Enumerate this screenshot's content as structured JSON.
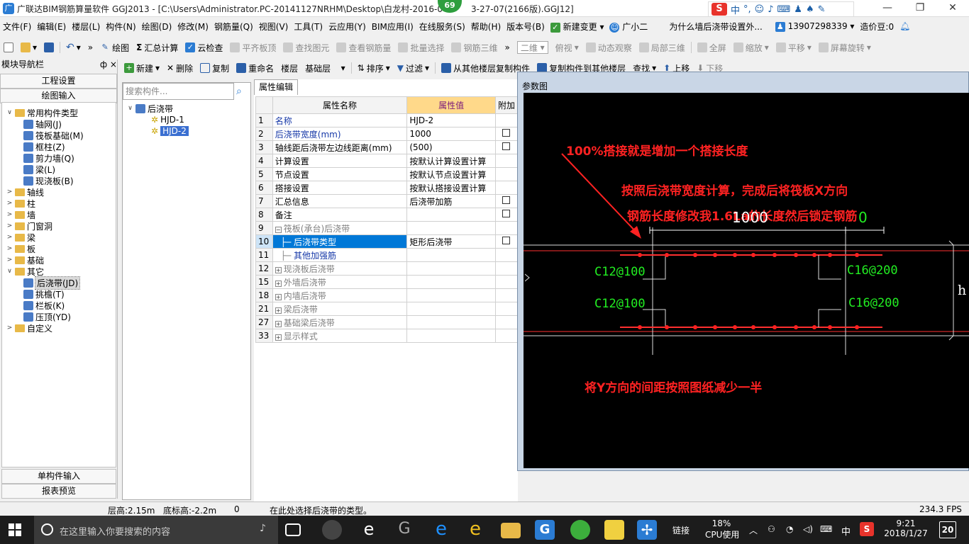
{
  "window": {
    "title": "广联达BIM钢筋算量软件 GGJ2013 - [C:\\Users\\Administrator.PC-20141127NRHM\\Desktop\\白龙村-2016-0",
    "title_tail": "3-27-07(2166版).GGJ12]",
    "badge": "69",
    "ime": {
      "s": "S",
      "lang": "中"
    }
  },
  "menu": {
    "items": [
      "文件(F)",
      "编辑(E)",
      "楼层(L)",
      "构件(N)",
      "绘图(D)",
      "修改(M)",
      "钢筋量(Q)",
      "视图(V)",
      "工具(T)",
      "云应用(Y)",
      "BIM应用(I)",
      "在线服务(S)",
      "帮助(H)",
      "版本号(B)"
    ],
    "new_change": "新建变更",
    "assistant": "广小二",
    "question": "为什么墙后浇带设置外...",
    "phone": "13907298339",
    "price": "造价豆:0"
  },
  "toolbar1": {
    "draw": "绘图",
    "sum": "汇总计算",
    "cloud_check": "云检查",
    "flat_slab": "平齐板顶",
    "find": "查找图元",
    "view_rebar": "查看钢筋量",
    "batch": "批量选择",
    "rebar3d": "钢筋三维",
    "view_mode": "二维",
    "top_view": "俯视",
    "dynamic": "动态观察",
    "local3d": "局部三维",
    "fullscreen": "全屏",
    "zoom": "缩放",
    "pan": "平移",
    "rotate": "屏幕旋转"
  },
  "toolbar2": {
    "new": "新建",
    "delete": "删除",
    "copy": "复制",
    "rename": "重命名",
    "floor_label": "楼层",
    "floor": "基础层",
    "sort": "排序",
    "filter": "过滤",
    "copy_from": "从其他楼层复制构件",
    "copy_to": "复制构件到其他楼层",
    "find": "查找",
    "up": "上移",
    "down": "下移"
  },
  "nav": {
    "header": "模块导航栏",
    "pin": "ф ×",
    "btn_project": "工程设置",
    "btn_draw": "绘图输入",
    "btn_single": "单构件输入",
    "btn_report": "报表预览",
    "tree": [
      {
        "label": "常用构件类型",
        "type": "folder",
        "expanded": true,
        "level": 0
      },
      {
        "label": "轴网(J)",
        "type": "item",
        "level": 1
      },
      {
        "label": "筏板基础(M)",
        "type": "item",
        "level": 1
      },
      {
        "label": "框柱(Z)",
        "type": "item",
        "level": 1
      },
      {
        "label": "剪力墙(Q)",
        "type": "item",
        "level": 1
      },
      {
        "label": "梁(L)",
        "type": "item",
        "level": 1
      },
      {
        "label": "现浇板(B)",
        "type": "item",
        "level": 1
      },
      {
        "label": "轴线",
        "type": "folder",
        "level": 0
      },
      {
        "label": "柱",
        "type": "folder",
        "level": 0
      },
      {
        "label": "墙",
        "type": "folder",
        "level": 0
      },
      {
        "label": "门窗洞",
        "type": "folder",
        "level": 0
      },
      {
        "label": "梁",
        "type": "folder",
        "level": 0
      },
      {
        "label": "板",
        "type": "folder",
        "level": 0
      },
      {
        "label": "基础",
        "type": "folder",
        "level": 0
      },
      {
        "label": "其它",
        "type": "folder",
        "expanded": true,
        "level": 0
      },
      {
        "label": "后浇带(JD)",
        "type": "item",
        "level": 1,
        "selected": true
      },
      {
        "label": "挑檐(T)",
        "type": "item",
        "level": 1
      },
      {
        "label": "栏板(K)",
        "type": "item",
        "level": 1
      },
      {
        "label": "压顶(YD)",
        "type": "item",
        "level": 1
      },
      {
        "label": "自定义",
        "type": "folder",
        "level": 0
      }
    ]
  },
  "components": {
    "search_placeholder": "搜索构件...",
    "root": "后浇带",
    "items": [
      "HJD-1",
      "HJD-2"
    ],
    "selected": "HJD-2"
  },
  "props": {
    "tab": "属性编辑",
    "headers": {
      "num": "",
      "name": "属性名称",
      "value": "属性值",
      "extra": "附加"
    },
    "rows": [
      {
        "n": "1",
        "name": "名称",
        "value": "HJD-2",
        "style": "blue",
        "cb": false
      },
      {
        "n": "2",
        "name": "后浇带宽度(mm)",
        "value": "1000",
        "style": "blue",
        "cb": true
      },
      {
        "n": "3",
        "name": "轴线距后浇带左边线距离(mm)",
        "value": "(500)",
        "style": "",
        "cb": true
      },
      {
        "n": "4",
        "name": "计算设置",
        "value": "按默认计算设置计算",
        "style": "",
        "cb": false
      },
      {
        "n": "5",
        "name": "节点设置",
        "value": "按默认节点设置计算",
        "style": "",
        "cb": false
      },
      {
        "n": "6",
        "name": "搭接设置",
        "value": "按默认搭接设置计算",
        "style": "",
        "cb": false
      },
      {
        "n": "7",
        "name": "汇总信息",
        "value": "后浇带加筋",
        "style": "",
        "cb": true
      },
      {
        "n": "8",
        "name": "备注",
        "value": "",
        "style": "",
        "cb": true
      },
      {
        "n": "9",
        "name": "筏板(承台)后浇带",
        "value": "",
        "style": "grey",
        "pm": "−",
        "cb": false
      },
      {
        "n": "10",
        "name": "后浇带类型",
        "value": "矩形后浇带",
        "style": "sel",
        "indent": 2,
        "cb": true
      },
      {
        "n": "11",
        "name": "其他加强筋",
        "value": "",
        "style": "blue",
        "indent": 2,
        "cb": false
      },
      {
        "n": "12",
        "name": "现浇板后浇带",
        "value": "",
        "style": "grey",
        "pm": "+",
        "cb": false
      },
      {
        "n": "15",
        "name": "外墙后浇带",
        "value": "",
        "style": "grey",
        "pm": "+",
        "cb": false
      },
      {
        "n": "18",
        "name": "内墙后浇带",
        "value": "",
        "style": "grey",
        "pm": "+",
        "cb": false
      },
      {
        "n": "21",
        "name": "梁后浇带",
        "value": "",
        "style": "grey",
        "pm": "+",
        "cb": false
      },
      {
        "n": "27",
        "name": "基础梁后浇带",
        "value": "",
        "style": "grey",
        "pm": "+",
        "cb": false
      },
      {
        "n": "33",
        "name": "显示样式",
        "value": "",
        "style": "grey",
        "pm": "+",
        "cb": false
      }
    ]
  },
  "reference": {
    "caption": "参数图",
    "annotations": {
      "line1": "100%搭接就是增加一个搭接长度",
      "line2": "按照后浇带宽度计算，完成后将筏板X方向",
      "line3": "钢筋长度修改我1.6La的长度然后锁定钢筋",
      "line4": "将Y方向的间距按照图纸减少一半"
    },
    "dim_width": "1000",
    "dim_extra": "0",
    "left_top": "C12@100",
    "left_bottom": "C12@100",
    "right_top": "C16@200",
    "right_bottom": "C16@200",
    "h_label": "h",
    "colors": {
      "annotation": "#ff2222",
      "green": "#22ee22",
      "white": "#ffffff",
      "bg": "#000000"
    }
  },
  "status": {
    "floor_height": "层高:2.15m",
    "bottom_height": "底标高:-2.2m",
    "zero": "0",
    "hint": "在此处选择后浇带的类型。",
    "fps": "234.3 FPS"
  },
  "taskbar": {
    "search_placeholder": "在这里输入你要搜索的内容",
    "link": "链接",
    "cpu_pct": "18%",
    "cpu_label": "CPU使用",
    "lang": "中",
    "time": "9:21",
    "date": "2018/1/27",
    "notif": "20"
  }
}
